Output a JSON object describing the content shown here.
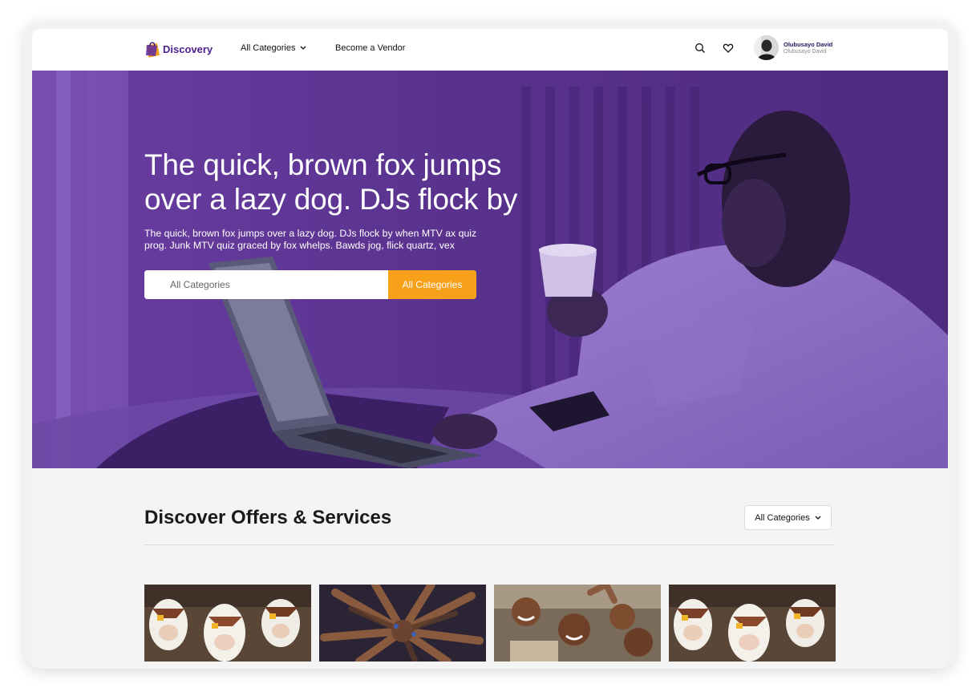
{
  "brand": {
    "name": "Discovery",
    "color": "#4b1f8c",
    "accent": "#f7a11a"
  },
  "nav": {
    "categories_label": "All Categories",
    "vendor_label": "Become a Vendor",
    "user": {
      "name": "Olubusayo David",
      "subtitle": "Olubusayo David"
    }
  },
  "hero": {
    "title": "The quick, brown fox jumps over a lazy dog. DJs flock by",
    "subtitle": "The quick, brown fox jumps over a lazy dog. DJs flock by when MTV ax quiz prog. Junk MTV quiz graced by fox whelps. Bawds jog, flick quartz, vex",
    "search_placeholder": "All Categories",
    "search_button": "All Categories"
  },
  "section": {
    "title": "Discover Offers & Services",
    "filter_label": "All Categories"
  },
  "cards": [
    {
      "image": "cows-photo"
    },
    {
      "image": "joined-hands-photo"
    },
    {
      "image": "smiling-children-photo"
    },
    {
      "image": "cows-photo"
    }
  ]
}
